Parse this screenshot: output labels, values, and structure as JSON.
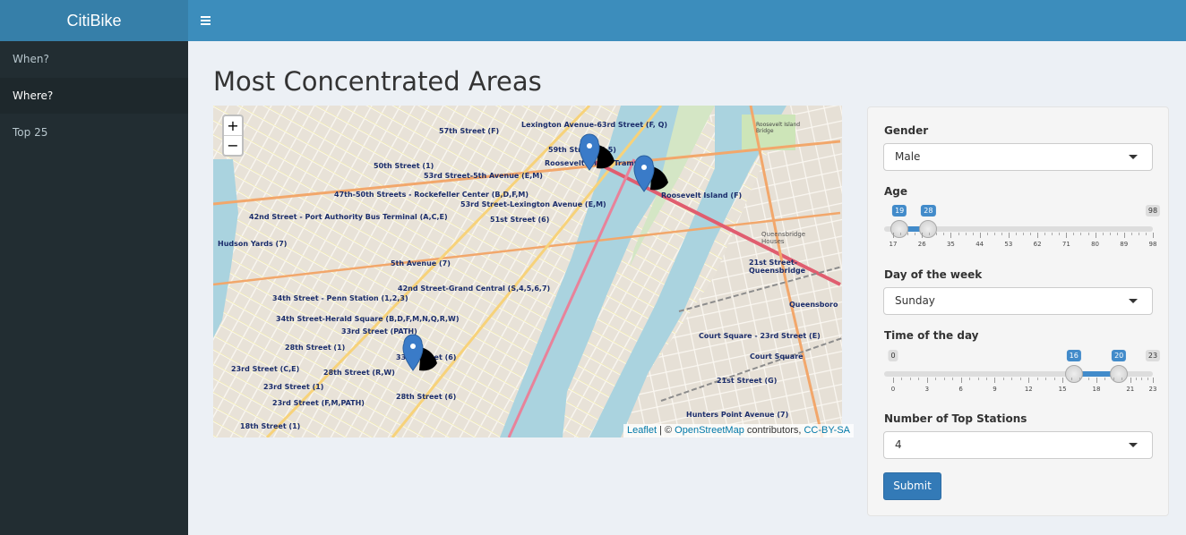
{
  "app": {
    "title": "CitiBike"
  },
  "sidebar": {
    "items": [
      {
        "label": "When?",
        "active": false
      },
      {
        "label": "Where?",
        "active": true
      },
      {
        "label": "Top 25",
        "active": false
      }
    ]
  },
  "main": {
    "title": "Most Concentrated Areas"
  },
  "map": {
    "zoom_in": "+",
    "zoom_out": "−",
    "attribution": {
      "leaflet": "Leaflet",
      "sep": " | © ",
      "osm": "OpenStreetMap",
      "contrib": " contributors, ",
      "license": "CC-BY-SA"
    },
    "labels": [
      "Lexington Avenue-63rd Street (F, Q)",
      "57th Street (F)",
      "59th Street (4,5)",
      "Roosevelt Island Tramway",
      "Roosevelt Island (F)",
      "50th Street (1)",
      "53rd Street-5th Avenue (E,M)",
      "47th-50th Streets - Rockefeller Center (B,D,F,M)",
      "53rd Street-Lexington Avenue (E,M)",
      "51st Street (6)",
      "42nd Street - Port Authority Bus Terminal (A,C,E)",
      "Hudson Yards (7)",
      "5th Avenue (7)",
      "42nd Street-Grand Central (S,4,5,6,7)",
      "34th Street - Penn Station (1,2,3)",
      "34th Street-Herald Square (B,D,F,M,N,Q,R,W)",
      "33rd Street (PATH)",
      "28th Street (1)",
      "23rd Street (C,E)",
      "28th Street (R,W)",
      "28th Street (6)",
      "23rd Street (1)",
      "23rd Street (F,M,PATH)",
      "18th Street (1)",
      "21st Street-Queensbridge",
      "Queensboro",
      "Court Square - 23rd Street (E)",
      "Court Square",
      "21st Street (G)",
      "Hunters Point Avenue (7)",
      "Queensbridge Houses",
      "Roosevelt Island Bridge",
      "33rd Street (6)"
    ]
  },
  "form": {
    "gender": {
      "label": "Gender",
      "value": "Male"
    },
    "age": {
      "label": "Age",
      "from": 19,
      "to": 28,
      "min": 17,
      "max": 98,
      "from_label": "19",
      "to_label": "28",
      "max_label": "98",
      "ticks": [
        "17",
        "26",
        "35",
        "44",
        "53",
        "62",
        "71",
        "80",
        "89",
        "98"
      ]
    },
    "day": {
      "label": "Day of the week",
      "value": "Sunday"
    },
    "time": {
      "label": "Time of the day",
      "from": 16,
      "to": 20,
      "min": 0,
      "max": 23,
      "min_label": "0",
      "from_label": "16",
      "to_label": "20",
      "max_label": "23",
      "ticks": [
        "0",
        "3",
        "6",
        "9",
        "12",
        "15",
        "18",
        "21",
        "23"
      ]
    },
    "top_stations": {
      "label": "Number of Top Stations",
      "value": "4"
    },
    "submit_label": "Submit"
  },
  "colors": {
    "header": "#3c8dbc",
    "logo": "#367fa9",
    "sidebar": "#222d32",
    "accent": "#428bca",
    "marker": "#3a7bc8"
  }
}
